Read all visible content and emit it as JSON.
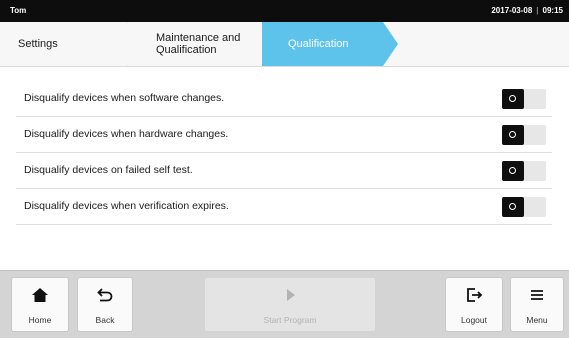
{
  "status_bar": {
    "user": "Tom",
    "date": "2017-03-08",
    "separator": "|",
    "time": "09:15"
  },
  "breadcrumb": {
    "items": [
      "Settings",
      "Maintenance and Qualification",
      "Qualification"
    ],
    "maint_line1": "Maintenance and",
    "maint_line2": "Qualification",
    "active_index": 2,
    "active_color": "#5ec3ea"
  },
  "settings": [
    {
      "label": "Disqualify devices when software changes.",
      "state": "off"
    },
    {
      "label": "Disqualify devices when hardware changes.",
      "state": "off"
    },
    {
      "label": "Disqualify devices on failed self test.",
      "state": "off"
    },
    {
      "label": "Disqualify devices when verification expires.",
      "state": "off"
    }
  ],
  "bottom_bar": {
    "home": {
      "label": "Home",
      "icon": "home-icon"
    },
    "back": {
      "label": "Back",
      "icon": "back-arrow-icon"
    },
    "start": {
      "label": "Start Program",
      "icon": "play-icon",
      "enabled": false
    },
    "logout": {
      "label": "Logout",
      "icon": "logout-icon"
    },
    "menu": {
      "label": "Menu",
      "icon": "menu-icon"
    }
  }
}
